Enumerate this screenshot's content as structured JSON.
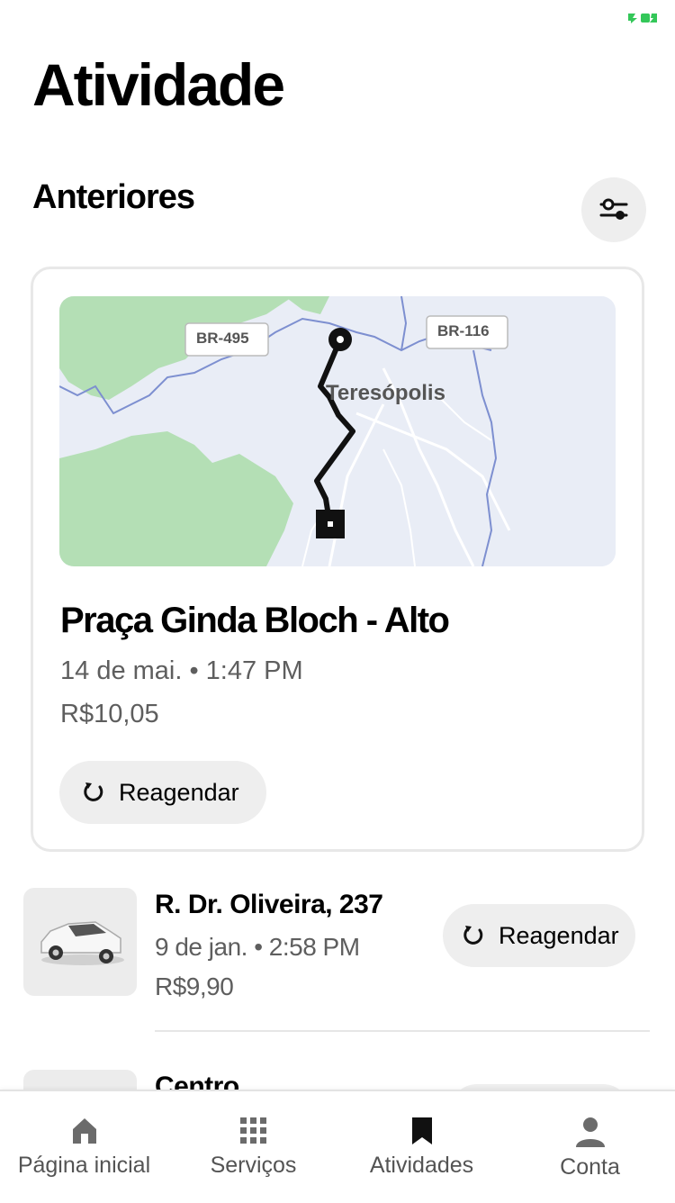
{
  "header": {
    "title": "Atividade"
  },
  "status": {
    "icon": "battery-charging-icon",
    "color": "#34c759"
  },
  "section": {
    "title": "Anteriores",
    "filter_icon": "sliders-icon"
  },
  "featured_trip": {
    "map": {
      "road_labels": [
        "BR-495",
        "BR-116"
      ],
      "city_label": "Teresópolis"
    },
    "title": "Praça Ginda Bloch - Alto",
    "meta": "14 de mai. • 1:47 PM",
    "price": "R$10,05",
    "rebook_label": "Reagendar",
    "rebook_icon": "refresh-icon"
  },
  "trips": [
    {
      "title": "R. Dr. Oliveira, 237",
      "meta": "9 de jan. • 2:58 PM",
      "price": "R$9,90",
      "rebook_label": "Reagendar",
      "thumb_icon": "car-icon"
    },
    {
      "title": "Centro"
    }
  ],
  "nav": {
    "items": [
      {
        "label": "Página inicial",
        "icon": "home-icon"
      },
      {
        "label": "Serviços",
        "icon": "grid-icon"
      },
      {
        "label": "Atividades",
        "icon": "bookmark-icon",
        "active": true
      },
      {
        "label": "Conta",
        "icon": "person-icon"
      }
    ]
  },
  "colors": {
    "accent": "#000000",
    "muted_text": "#5e5e5e",
    "pill_bg": "#eeeeee",
    "map_green": "#b4dfb5",
    "map_water": "#7d8fd0"
  }
}
